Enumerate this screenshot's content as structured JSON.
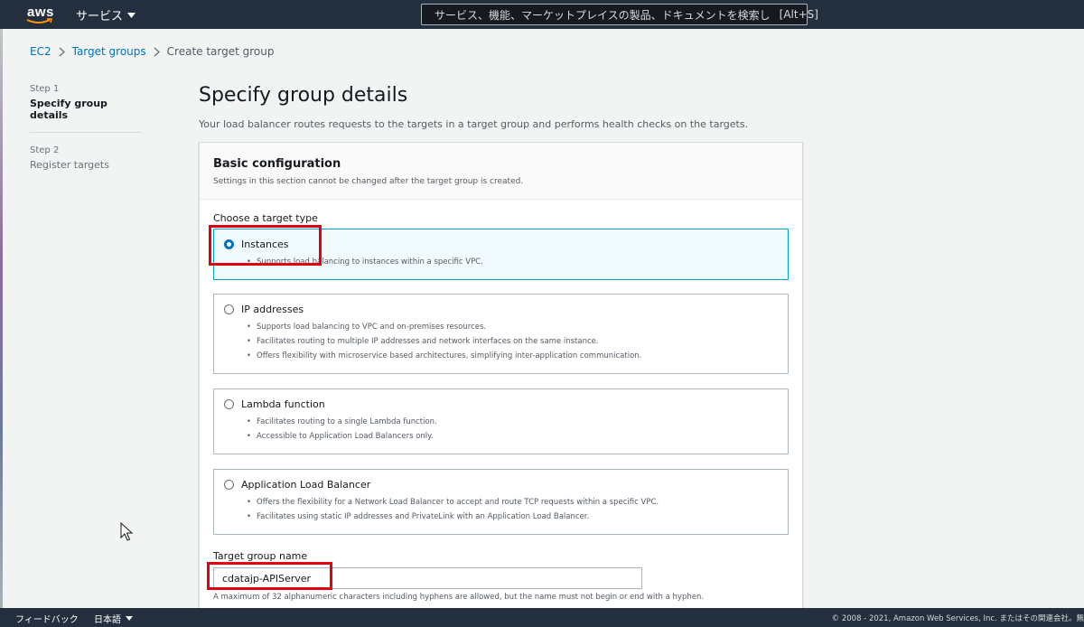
{
  "nav": {
    "logo": "aws",
    "services_label": "サービス",
    "search_placeholder": "サービス、機能、マーケットプレイスの製品、ドキュメントを検索し",
    "search_shortcut": "[Alt+S]"
  },
  "breadcrumb": {
    "items": [
      "EC2",
      "Target groups",
      "Create target group"
    ]
  },
  "steps": [
    {
      "num": "Step 1",
      "title": "Specify group details"
    },
    {
      "num": "Step 2",
      "title": "Register targets"
    }
  ],
  "main": {
    "title": "Specify group details",
    "description": "Your load balancer routes requests to the targets in a target group and performs health checks on the targets."
  },
  "panel": {
    "title": "Basic configuration",
    "subtitle": "Settings in this section cannot be changed after the target group is created.",
    "target_type_label": "Choose a target type",
    "options": [
      {
        "label": "Instances",
        "selected": true,
        "bullets": [
          "Supports load balancing to instances within a specific VPC."
        ]
      },
      {
        "label": "IP addresses",
        "selected": false,
        "bullets": [
          "Supports load balancing to VPC and on-premises resources.",
          "Facilitates routing to multiple IP addresses and network interfaces on the same instance.",
          "Offers flexibility with microservice based architectures, simplifying inter-application communication."
        ]
      },
      {
        "label": "Lambda function",
        "selected": false,
        "bullets": [
          "Facilitates routing to a single Lambda function.",
          "Accessible to Application Load Balancers only."
        ]
      },
      {
        "label": "Application Load Balancer",
        "selected": false,
        "bullets": [
          "Offers the flexibility for a Network Load Balancer to accept and route TCP requests within a specific VPC.",
          "Facilitates using static IP addresses and PrivateLink with an Application Load Balancer."
        ]
      }
    ],
    "name_label": "Target group name",
    "name_value": "cdatajp-APIServer",
    "name_hint": "A maximum of 32 alphanumeric characters including hyphens are allowed, but the name must not begin or end with a hyphen."
  },
  "footer": {
    "feedback": "フィードバック",
    "language": "日本語",
    "copyright": "© 2008 - 2021, Amazon Web Services, Inc. またはその関連会社。無"
  },
  "colors": {
    "nav_bg": "#232f3e",
    "link": "#0073bb",
    "selected_border": "#00a1c9",
    "highlight": "#e3000f"
  }
}
